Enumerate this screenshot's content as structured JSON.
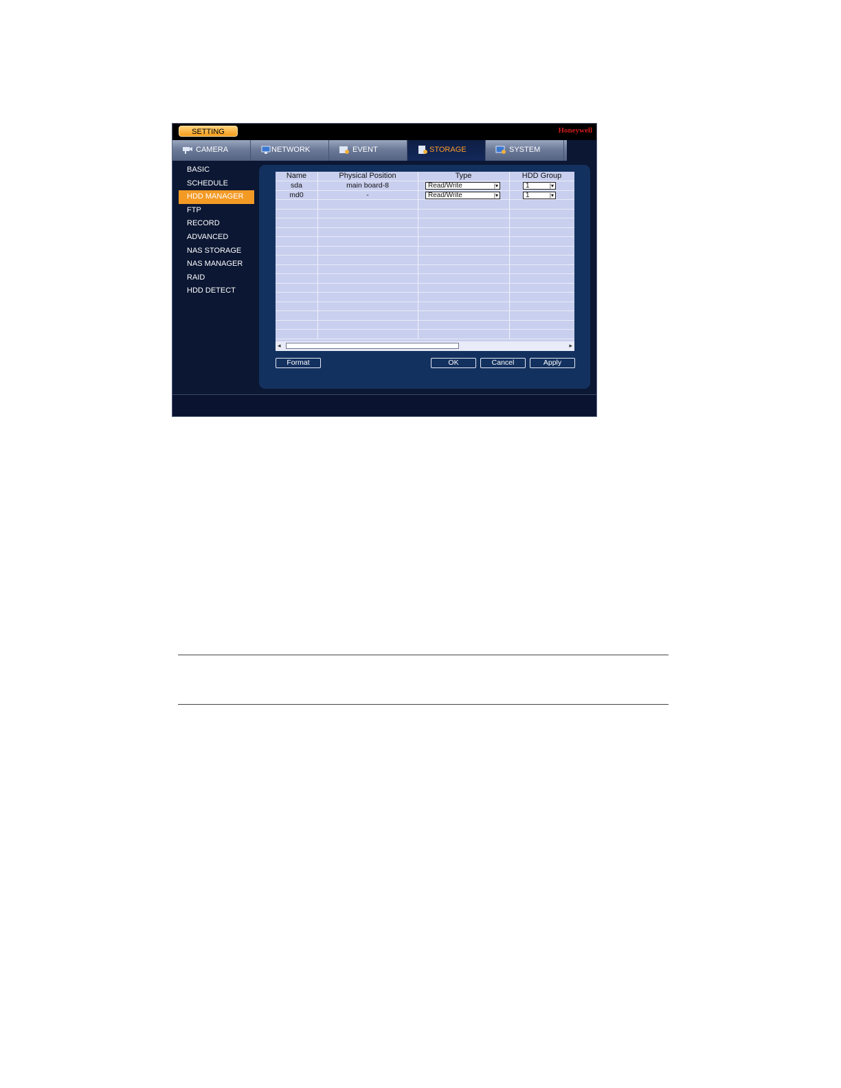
{
  "titlebar": {
    "setting_label": "SETTING",
    "brand": "Honeywell"
  },
  "tabs": [
    {
      "label": "CAMERA",
      "icon": "camera-icon"
    },
    {
      "label": "NETWORK",
      "icon": "network-icon"
    },
    {
      "label": "EVENT",
      "icon": "event-icon"
    },
    {
      "label": "STORAGE",
      "icon": "storage-icon",
      "active": true
    },
    {
      "label": "SYSTEM",
      "icon": "system-icon"
    }
  ],
  "sidebar": {
    "items": [
      {
        "label": "BASIC"
      },
      {
        "label": "SCHEDULE"
      },
      {
        "label": "HDD MANAGER",
        "active": true
      },
      {
        "label": "FTP"
      },
      {
        "label": "RECORD"
      },
      {
        "label": "ADVANCED"
      },
      {
        "label": "NAS STORAGE"
      },
      {
        "label": "NAS MANAGER"
      },
      {
        "label": "RAID"
      },
      {
        "label": "HDD DETECT"
      }
    ]
  },
  "table": {
    "headers": [
      "Name",
      "Physical Position",
      "Type",
      "HDD Group"
    ],
    "rows": [
      {
        "name": "sda",
        "position": "main board-8",
        "type": "Read/Write",
        "group": "1"
      },
      {
        "name": "md0",
        "position": "-",
        "type": "Read/Write",
        "group": "1"
      }
    ]
  },
  "buttons": {
    "format": "Format",
    "ok": "OK",
    "cancel": "Cancel",
    "apply": "Apply"
  },
  "colors": {
    "accent": "#f39a25",
    "background": "#0b1733",
    "panel": "#13315f",
    "brand": "#d11c1c"
  }
}
